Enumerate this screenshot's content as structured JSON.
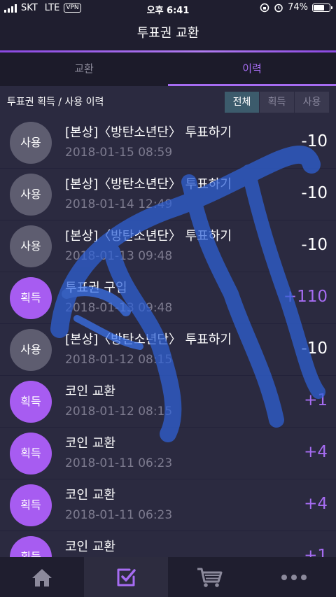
{
  "status_bar": {
    "carrier": "SKT",
    "network": "LTE",
    "vpn": "VPN",
    "time": "오후 6:41",
    "battery_percent": "74%",
    "battery_level": 0.74
  },
  "header": {
    "title": "투표권 교환"
  },
  "tabs": [
    {
      "label": "교환",
      "active": false
    },
    {
      "label": "이력",
      "active": true
    }
  ],
  "filter": {
    "title": "투표권 획득 / 사용 이력",
    "options": [
      {
        "label": "전체",
        "active": true
      },
      {
        "label": "획득",
        "active": false
      },
      {
        "label": "사용",
        "active": false
      }
    ]
  },
  "history": [
    {
      "type": "사용",
      "kind": "use",
      "title": "[본상]〈방탄소년단〉 투표하기",
      "date": "2018-01-15 08:59",
      "amount": "-10"
    },
    {
      "type": "사용",
      "kind": "use",
      "title": "[본상]〈방탄소년단〉 투표하기",
      "date": "2018-01-14 12:49",
      "amount": "-10"
    },
    {
      "type": "사용",
      "kind": "use",
      "title": "[본상]〈방탄소년단〉 투표하기",
      "date": "2018-01-13 09:48",
      "amount": "-10"
    },
    {
      "type": "획득",
      "kind": "get",
      "title": "투표권 구입",
      "date": "2018-01-13 09:48",
      "amount": "+110"
    },
    {
      "type": "사용",
      "kind": "use",
      "title": "[본상]〈방탄소년단〉 투표하기",
      "date": "2018-01-12 08:15",
      "amount": "-10"
    },
    {
      "type": "획득",
      "kind": "get",
      "title": "코인 교환",
      "date": "2018-01-12 08:15",
      "amount": "+1"
    },
    {
      "type": "획득",
      "kind": "get",
      "title": "코인 교환",
      "date": "2018-01-11 06:23",
      "amount": "+4"
    },
    {
      "type": "획득",
      "kind": "get",
      "title": "코인 교환",
      "date": "2018-01-11 06:23",
      "amount": "+4"
    },
    {
      "type": "획득",
      "kind": "get",
      "title": "코인 교환",
      "date": "",
      "amount": "+1"
    }
  ],
  "bottom_nav": [
    {
      "icon": "home-icon",
      "active": false
    },
    {
      "icon": "vote-check-icon",
      "active": true
    },
    {
      "icon": "cart-icon",
      "active": false
    },
    {
      "icon": "more-icon",
      "active": false
    }
  ],
  "colors": {
    "accent": "#a66cf2",
    "badge_use": "#5e5d70",
    "badge_get": "#a75cf1",
    "filter_active": "#3c5b6c",
    "scribble": "#2f62d8"
  }
}
